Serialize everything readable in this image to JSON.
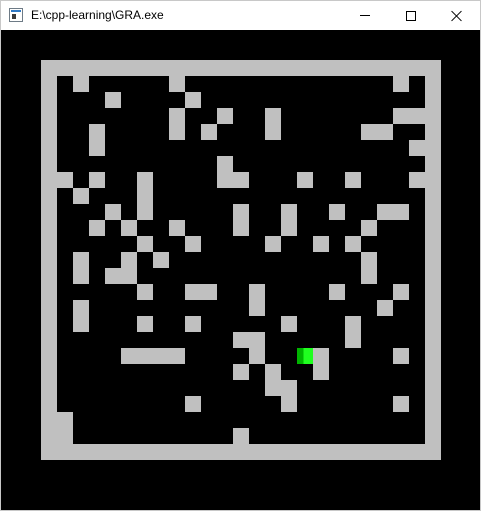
{
  "window": {
    "title": "E:\\cpp-learning\\GRA.exe",
    "icon": "console-app-icon",
    "controls": {
      "minimize": "minimize-icon",
      "maximize": "maximize-icon",
      "close": "close-icon"
    }
  },
  "colors": {
    "background": "#000000",
    "wall": "#c0c0c0",
    "player_dark": "#00b400",
    "player_light": "#20ff20"
  },
  "game": {
    "grid_cols": 25,
    "grid_rows": 25,
    "cell_size": 16,
    "border_rows": [
      0,
      24
    ],
    "border_cols": [
      0,
      24
    ],
    "walls": [
      [
        2,
        1
      ],
      [
        8,
        1
      ],
      [
        22,
        1
      ],
      [
        4,
        2
      ],
      [
        9,
        2
      ],
      [
        8,
        3
      ],
      [
        11,
        3
      ],
      [
        14,
        3
      ],
      [
        22,
        3
      ],
      [
        23,
        3
      ],
      [
        3,
        4
      ],
      [
        8,
        4
      ],
      [
        10,
        4
      ],
      [
        14,
        4
      ],
      [
        20,
        4
      ],
      [
        21,
        4
      ],
      [
        3,
        5
      ],
      [
        23,
        5
      ],
      [
        11,
        6
      ],
      [
        1,
        7
      ],
      [
        3,
        7
      ],
      [
        6,
        7
      ],
      [
        11,
        7
      ],
      [
        12,
        7
      ],
      [
        16,
        7
      ],
      [
        19,
        7
      ],
      [
        23,
        7
      ],
      [
        2,
        8
      ],
      [
        6,
        8
      ],
      [
        4,
        9
      ],
      [
        6,
        9
      ],
      [
        12,
        9
      ],
      [
        15,
        9
      ],
      [
        18,
        9
      ],
      [
        21,
        9
      ],
      [
        22,
        9
      ],
      [
        3,
        10
      ],
      [
        5,
        10
      ],
      [
        8,
        10
      ],
      [
        12,
        10
      ],
      [
        15,
        10
      ],
      [
        20,
        10
      ],
      [
        6,
        11
      ],
      [
        9,
        11
      ],
      [
        14,
        11
      ],
      [
        17,
        11
      ],
      [
        19,
        11
      ],
      [
        2,
        12
      ],
      [
        5,
        12
      ],
      [
        7,
        12
      ],
      [
        20,
        12
      ],
      [
        2,
        13
      ],
      [
        4,
        13
      ],
      [
        5,
        13
      ],
      [
        20,
        13
      ],
      [
        6,
        14
      ],
      [
        9,
        14
      ],
      [
        10,
        14
      ],
      [
        13,
        14
      ],
      [
        18,
        14
      ],
      [
        22,
        14
      ],
      [
        2,
        15
      ],
      [
        13,
        15
      ],
      [
        21,
        15
      ],
      [
        2,
        16
      ],
      [
        6,
        16
      ],
      [
        9,
        16
      ],
      [
        15,
        16
      ],
      [
        19,
        16
      ],
      [
        12,
        17
      ],
      [
        13,
        17
      ],
      [
        19,
        17
      ],
      [
        5,
        18
      ],
      [
        6,
        18
      ],
      [
        7,
        18
      ],
      [
        8,
        18
      ],
      [
        13,
        18
      ],
      [
        17,
        18
      ],
      [
        22,
        18
      ],
      [
        12,
        19
      ],
      [
        14,
        19
      ],
      [
        17,
        19
      ],
      [
        14,
        20
      ],
      [
        15,
        20
      ],
      [
        9,
        21
      ],
      [
        15,
        21
      ],
      [
        22,
        21
      ],
      [
        1,
        22
      ],
      [
        1,
        23
      ],
      [
        12,
        23
      ]
    ],
    "player": {
      "col": 16,
      "row": 18
    }
  }
}
